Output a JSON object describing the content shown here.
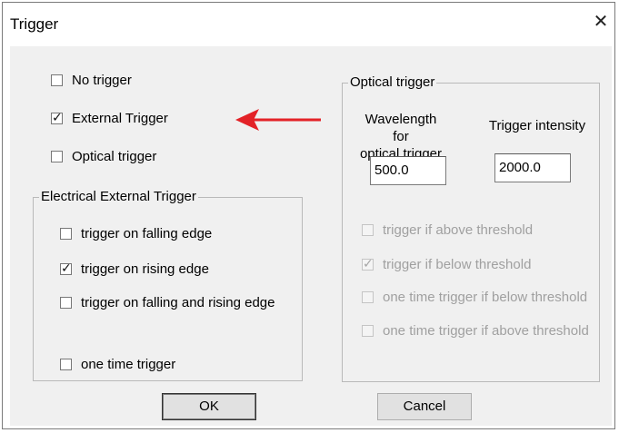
{
  "dialog": {
    "title": "Trigger",
    "close_glyph": "✕"
  },
  "mode": {
    "no_trigger": {
      "label": "No trigger",
      "checked": false
    },
    "external_trigger": {
      "label": "External Trigger",
      "checked": true
    },
    "optical_trigger": {
      "label": "Optical trigger",
      "checked": false
    }
  },
  "electrical_group": {
    "title": "Electrical External Trigger",
    "falling": {
      "label": "trigger on falling edge",
      "checked": false
    },
    "rising": {
      "label": "trigger on rising edge",
      "checked": true
    },
    "both": {
      "label": "trigger on falling and rising edge",
      "checked": false
    },
    "one_time": {
      "label": "one time trigger",
      "checked": false
    }
  },
  "optical_group": {
    "title": "Optical trigger",
    "wavelength_label_line1": "Wavelength for",
    "wavelength_label_line2": "optical trigger",
    "wavelength_value": "500.0",
    "intensity_label": "Trigger intensity",
    "intensity_value": "2000.0",
    "above": {
      "label": "trigger if above threshold",
      "checked": false
    },
    "below": {
      "label": "trigger if below threshold",
      "checked": true
    },
    "one_time_below": {
      "label": "one time trigger if below threshold",
      "checked": false
    },
    "one_time_above": {
      "label": "one time trigger if above threshold",
      "checked": false
    }
  },
  "buttons": {
    "ok": "OK",
    "cancel": "Cancel"
  },
  "annotation": {
    "arrow_color": "#e32227",
    "icon": "arrow-left-icon"
  }
}
